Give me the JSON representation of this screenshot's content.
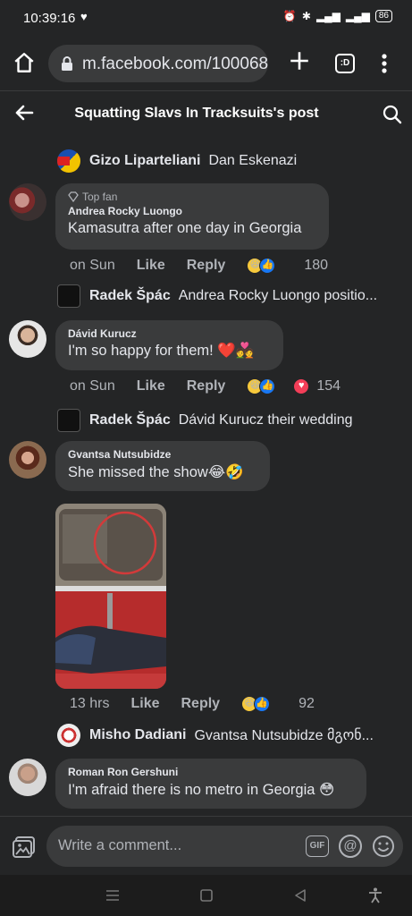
{
  "status": {
    "time": "10:39:16",
    "battery": "86"
  },
  "browser": {
    "url": "m.facebook.com/100068",
    "tabs_label": ":D"
  },
  "header": {
    "title": "Squatting Slavs In Tracksuits's post"
  },
  "comments": [
    {
      "type": "reply",
      "name": "Gizo Liparteliani",
      "text": "Dan Eskenazi"
    },
    {
      "type": "comment",
      "badge": "Top fan",
      "author": "Andrea Rocky Luongo",
      "text": "Kamasutra after one day in Georgia",
      "time": "on Sun",
      "like": "Like",
      "reply": "Reply",
      "reaction_count": "180"
    },
    {
      "type": "reply",
      "name": "Radek Špác",
      "text": "Andrea Rocky Luongo positio..."
    },
    {
      "type": "comment",
      "author": "Dávid Kurucz",
      "text": "I'm so happy for them! ❤️💑",
      "time": "on Sun",
      "like": "Like",
      "reply": "Reply",
      "reaction_count": "154"
    },
    {
      "type": "reply",
      "name": "Radek Špác",
      "text": "Dávid Kurucz their wedding"
    },
    {
      "type": "comment",
      "author": "Gvantsa Nutsubidze",
      "text": "She missed the show😂🤣",
      "time": "13 hrs",
      "like": "Like",
      "reply": "Reply",
      "reaction_count": "92"
    },
    {
      "type": "reply",
      "name": "Misho Dadiani",
      "text": "Gvantsa Nutsubidze მგონ..."
    },
    {
      "type": "comment",
      "author": "Roman Ron Gershuni",
      "text": "I'm afraid there is no metro in Georgia 😳"
    }
  ],
  "composer": {
    "placeholder": "Write a comment...",
    "gif_label": "GIF",
    "at_label": "@"
  },
  "colors": {
    "background": "#242526",
    "bubble": "#3a3b3c",
    "text": "#e4e6eb",
    "muted": "#b0b3b8",
    "like_blue": "#1877f2"
  }
}
